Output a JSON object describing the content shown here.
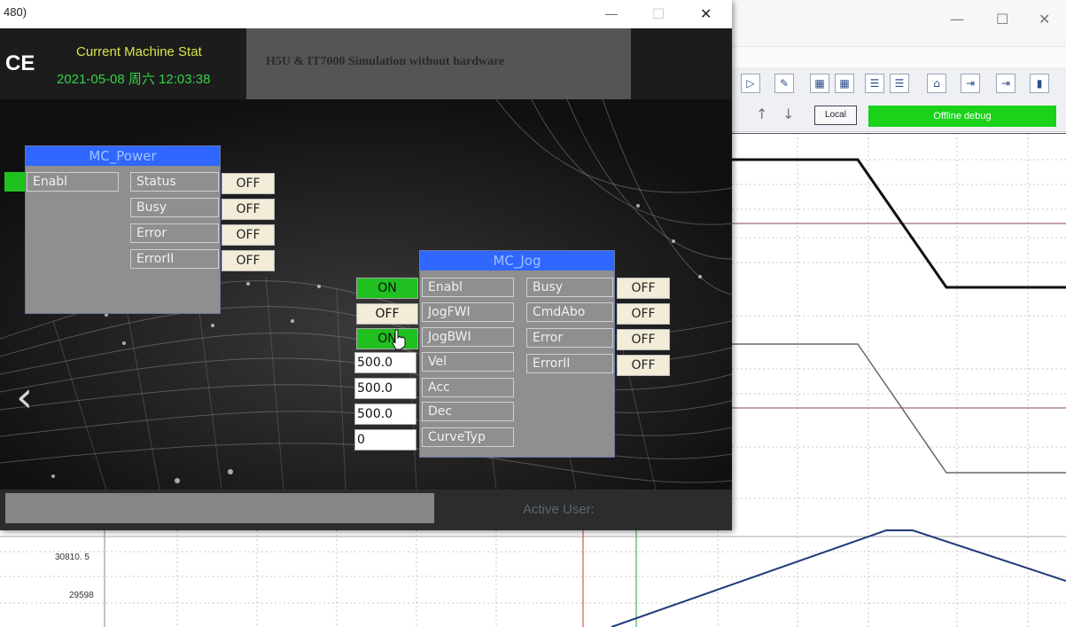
{
  "hmi": {
    "window_title": "480)",
    "brand": "CE",
    "machine_status": "Current Machine Stat",
    "datetime": "2021-05-08 周六 12:03:38",
    "simulation_banner": "H5U & IT7000 Simulation without hardware",
    "active_user_label": "Active User:",
    "window_controls": {
      "minimize": "—",
      "maximize": "☐",
      "close": "✕"
    },
    "back_arrow": "‹",
    "mc_power": {
      "title": "MC_Power",
      "input_label": "Enabl",
      "outputs": [
        {
          "label": "Status",
          "value": "OFF"
        },
        {
          "label": "Busy",
          "value": "OFF"
        },
        {
          "label": "Error",
          "value": "OFF"
        },
        {
          "label": "ErrorII",
          "value": "OFF"
        }
      ]
    },
    "mc_jog": {
      "title": "MC_Jog",
      "inputs": [
        {
          "label": "Enabl",
          "value": "ON"
        },
        {
          "label": "JogFWI",
          "value": "OFF"
        },
        {
          "label": "JogBWI",
          "value": "ON"
        },
        {
          "label": "Vel",
          "value": "500.0"
        },
        {
          "label": "Acc",
          "value": "500.0"
        },
        {
          "label": "Dec",
          "value": "500.0"
        },
        {
          "label": "CurveTyp",
          "value": "0"
        }
      ],
      "outputs": [
        {
          "label": "Busy",
          "value": "OFF"
        },
        {
          "label": "CmdAbo",
          "value": "OFF"
        },
        {
          "label": "Error",
          "value": "OFF"
        },
        {
          "label": "ErrorII",
          "value": "OFF"
        }
      ]
    }
  },
  "trend": {
    "window_controls": {
      "minimize": "—",
      "maximize": "☐",
      "close": "✕"
    },
    "local_button": "Local",
    "status": "Offline debug",
    "status_color": "#19d219",
    "up_arrow": "↑",
    "down_arrow": "↓",
    "y_ticks": [
      "30810. 5",
      "29598"
    ]
  },
  "colors": {
    "block_header": "#2f67ff",
    "on_green": "#20c020",
    "off_beige": "#f2ecd8"
  }
}
